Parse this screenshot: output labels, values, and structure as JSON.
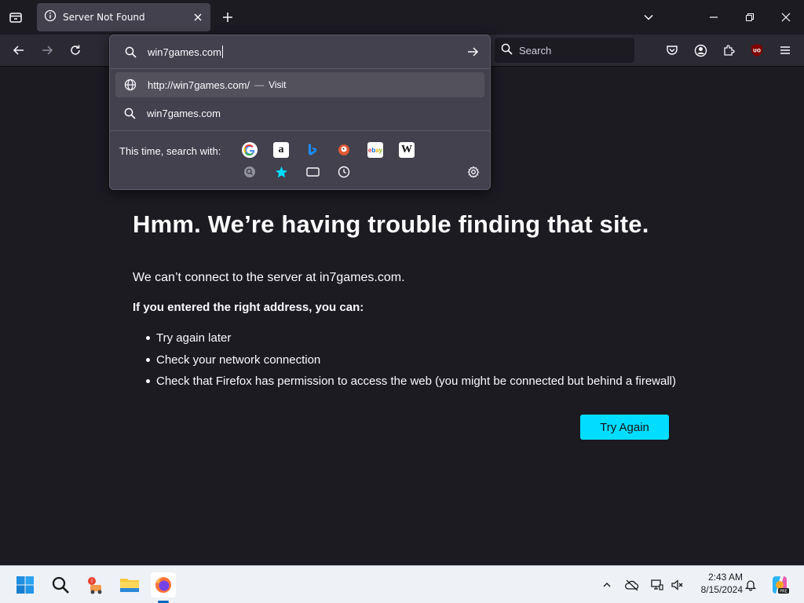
{
  "tab": {
    "title": "Server Not Found"
  },
  "urlbar": {
    "value": "win7games.com",
    "suggestions": [
      {
        "text": "http://win7games.com/",
        "dash": "—",
        "action": "Visit",
        "icon": "globe-icon"
      },
      {
        "text": "win7games.com",
        "icon": "search-icon"
      }
    ],
    "search_with_label": "This time, search with:",
    "engines_row1": [
      "Google",
      "Amazon",
      "Bing",
      "DuckDuckGo",
      "eBay",
      "Wikipedia"
    ],
    "engines_row2": [
      "search-mode-icon",
      "bookmarks-star-icon",
      "tabs-icon",
      "history-clock-icon"
    ]
  },
  "search": {
    "placeholder": "Search"
  },
  "error": {
    "title": "Hmm. We’re having trouble finding that site.",
    "description": "We can’t connect to the server at in7games.com.",
    "subheading": "If you entered the right address, you can:",
    "items": [
      "Try again later",
      "Check your network connection",
      "Check that Firefox has permission to access the web (you might be connected but behind a firewall)"
    ],
    "button": "Try Again"
  },
  "taskbar": {
    "time": "2:43 AM",
    "date": "8/15/2024",
    "apps": [
      "start-icon",
      "search-icon",
      "app-icon",
      "file-explorer-icon",
      "firefox-icon"
    ]
  },
  "colors": {
    "accent": "#00ddff",
    "background": "#1c1b22",
    "toolbar": "#2b2a33",
    "panel": "#42414d"
  }
}
